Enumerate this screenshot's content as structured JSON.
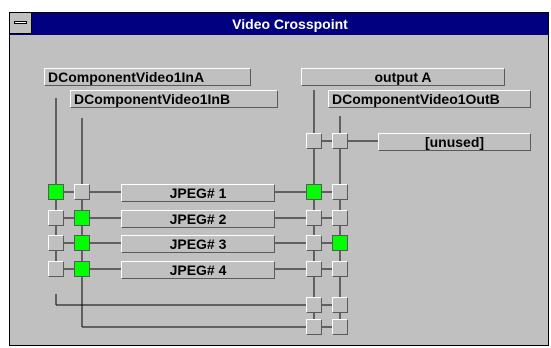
{
  "window": {
    "title": "Video Crosspoint",
    "system_menu_icon": "system-menu-icon"
  },
  "inputs": [
    {
      "label": "DComponentVideo1InA"
    },
    {
      "label": "DComponentVideo1InB"
    }
  ],
  "outputs": [
    {
      "label": "output A"
    },
    {
      "label": "DComponentVideo1OutB"
    }
  ],
  "unused_label": "[unused]",
  "jpeg_channels": [
    {
      "label": "JPEG# 1"
    },
    {
      "label": "JPEG# 2"
    },
    {
      "label": "JPEG# 3"
    },
    {
      "label": "JPEG# 4"
    }
  ],
  "active_color": "#00ff00",
  "crosspoints": {
    "input_side": [
      {
        "row": "JPEG# 1",
        "InA": true,
        "InB": false
      },
      {
        "row": "JPEG# 2",
        "InA": false,
        "InB": true
      },
      {
        "row": "JPEG# 3",
        "InA": false,
        "InB": true
      },
      {
        "row": "JPEG# 4",
        "InA": false,
        "InB": true
      }
    ],
    "output_side": [
      {
        "row": "[unused]",
        "OutA": false,
        "OutB": false
      },
      {
        "row": "JPEG# 1",
        "OutA": true,
        "OutB": false
      },
      {
        "row": "JPEG# 2",
        "OutA": false,
        "OutB": false
      },
      {
        "row": "JPEG# 3",
        "OutA": false,
        "OutB": true
      },
      {
        "row": "JPEG# 4",
        "OutA": false,
        "OutB": false
      },
      {
        "row": "InA loop",
        "OutA": false,
        "OutB": false
      },
      {
        "row": "InB loop",
        "OutA": false,
        "OutB": false
      }
    ]
  }
}
